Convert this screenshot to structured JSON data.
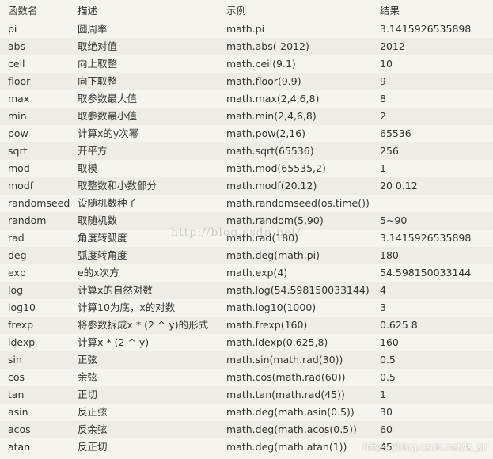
{
  "header": {
    "name": "函数名",
    "desc": "描述",
    "example": "示例",
    "result": "结果"
  },
  "rows": [
    {
      "name": "pi",
      "desc": "圆周率",
      "example": "math.pi",
      "result": "3.1415926535898"
    },
    {
      "name": "abs",
      "desc": "取绝对值",
      "example": "math.abs(-2012)",
      "result": "2012"
    },
    {
      "name": "ceil",
      "desc": "向上取整",
      "example": "math.ceil(9.1)",
      "result": "10"
    },
    {
      "name": "floor",
      "desc": "向下取整",
      "example": "math.floor(9.9)",
      "result": "9"
    },
    {
      "name": "max",
      "desc": "取参数最大值",
      "example": "math.max(2,4,6,8)",
      "result": "8"
    },
    {
      "name": "min",
      "desc": "取参数最小值",
      "example": "math.min(2,4,6,8)",
      "result": "2"
    },
    {
      "name": "pow",
      "desc": "计算x的y次幂",
      "example": "math.pow(2,16)",
      "result": "65536"
    },
    {
      "name": "sqrt",
      "desc": "开平方",
      "example": "math.sqrt(65536)",
      "result": "256"
    },
    {
      "name": "mod",
      "desc": "取模",
      "example": "math.mod(65535,2)",
      "result": "1"
    },
    {
      "name": "modf",
      "desc": "取整数和小数部分",
      "example": "math.modf(20.12)",
      "result": "20   0.12"
    },
    {
      "name": "randomseed",
      "desc": "设随机数种子",
      "example": "math.randomseed(os.time())",
      "result": ""
    },
    {
      "name": "random",
      "desc": "取随机数",
      "example": "math.random(5,90)",
      "result": "5~90"
    },
    {
      "name": "rad",
      "desc": "角度转弧度",
      "example": "math.rad(180)",
      "result": "3.1415926535898"
    },
    {
      "name": "deg",
      "desc": "弧度转角度",
      "example": "math.deg(math.pi)",
      "result": "180"
    },
    {
      "name": "exp",
      "desc": "e的x次方",
      "example": "math.exp(4)",
      "result": "54.598150033144"
    },
    {
      "name": "log",
      "desc": "计算x的自然对数",
      "example": "math.log(54.598150033144)",
      "result": "4"
    },
    {
      "name": "log10",
      "desc": "计算10为底，x的对数",
      "example": "math.log10(1000)",
      "result": "3"
    },
    {
      "name": "frexp",
      "desc": "将参数拆成x * (2 ^ y)的形式",
      "example": "math.frexp(160)",
      "result": "0.625    8"
    },
    {
      "name": "ldexp",
      "desc": "计算x * (2 ^ y)",
      "example": "math.ldexp(0.625,8)",
      "result": "160"
    },
    {
      "name": "sin",
      "desc": "正弦",
      "example": "math.sin(math.rad(30))",
      "result": "0.5"
    },
    {
      "name": "cos",
      "desc": "余弦",
      "example": "math.cos(math.rad(60))",
      "result": "0.5"
    },
    {
      "name": "tan",
      "desc": "正切",
      "example": "math.tan(math.rad(45))",
      "result": "1"
    },
    {
      "name": "asin",
      "desc": "反正弦",
      "example": "math.deg(math.asin(0.5))",
      "result": "30"
    },
    {
      "name": "acos",
      "desc": "反余弦",
      "example": "math.deg(math.acos(0.5))",
      "result": "60"
    },
    {
      "name": "atan",
      "desc": "反正切",
      "example": "math.deg(math.atan(1))",
      "result": "45"
    }
  ],
  "watermark": "http://blog.csdn.net/",
  "footer_watermark": "https://blog.csdn.net/ls_sir"
}
